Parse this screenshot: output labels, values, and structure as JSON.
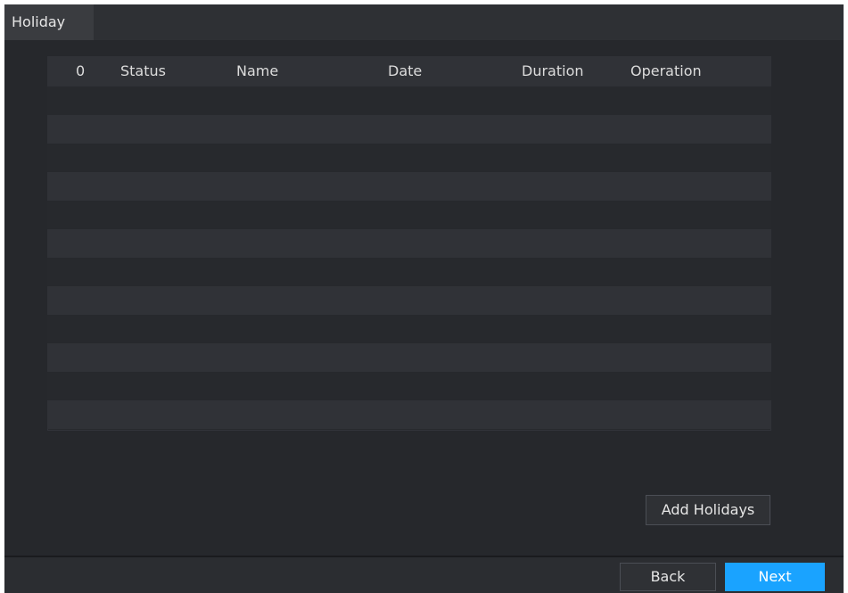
{
  "window": {
    "tab_label": "Holiday"
  },
  "table": {
    "columns": [
      "0",
      "Status",
      "Name",
      "Date",
      "Duration",
      "Operation"
    ],
    "rows": []
  },
  "buttons": {
    "add_holidays": "Add Holidays",
    "back": "Back",
    "next": "Next"
  },
  "colors": {
    "accent": "#1aa3ff",
    "background": "#26282c"
  }
}
